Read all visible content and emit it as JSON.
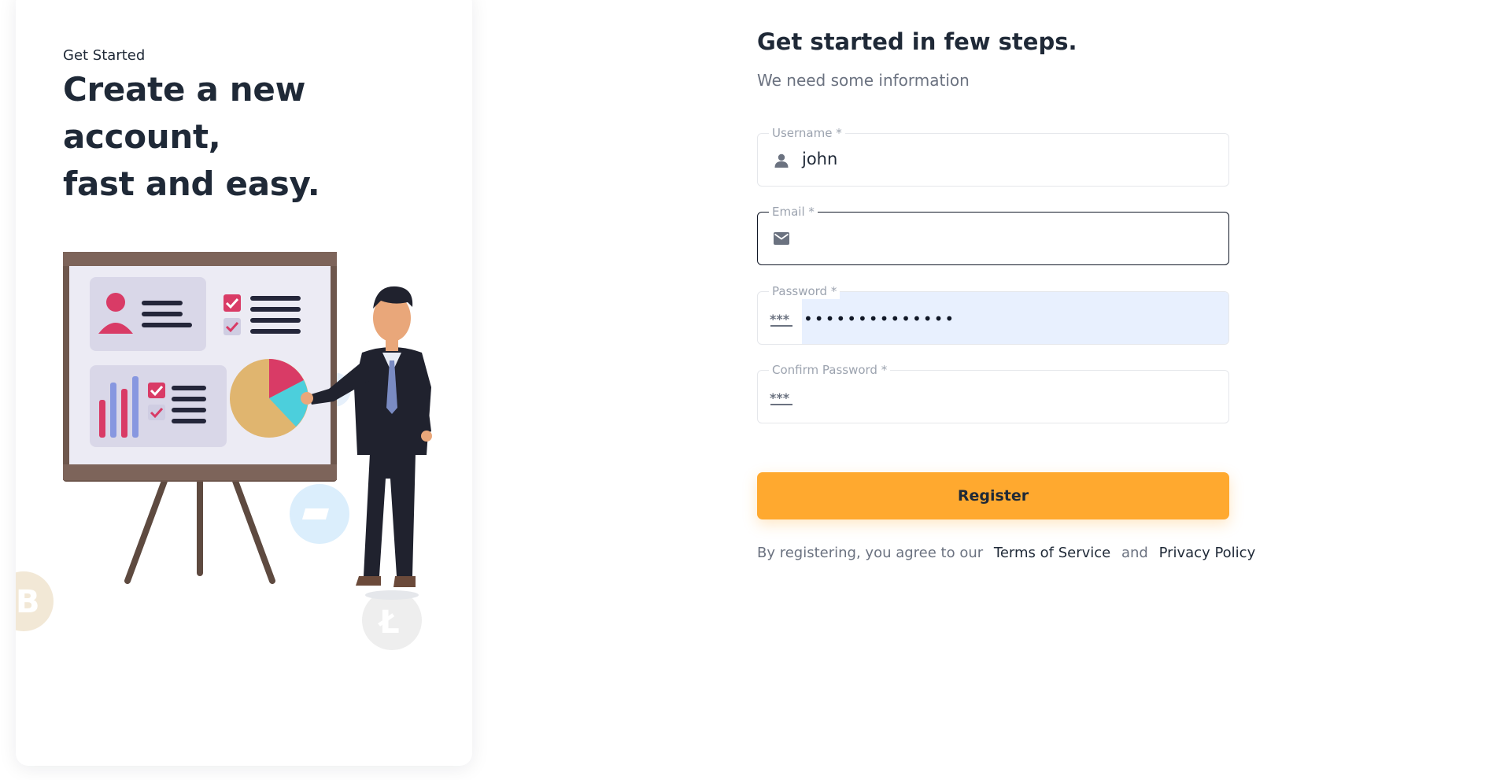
{
  "left_panel": {
    "eyebrow": "Get Started",
    "headline_line1": "Create a new account,",
    "headline_line2": "fast and easy."
  },
  "form": {
    "title": "Get started in few steps.",
    "subtitle": "We need some information",
    "fields": [
      {
        "label": "Username *",
        "value": "john",
        "icon": "person-icon"
      },
      {
        "label": "Email *",
        "value": "",
        "icon": "envelope-icon"
      },
      {
        "label": "Password *",
        "value": "••••••••••••••",
        "icon": "password-dots-icon"
      },
      {
        "label": "Confirm Password *",
        "value": "",
        "icon": "password-dots-icon"
      }
    ],
    "register_label": "Register",
    "agree_text": "By registering, you agree to our",
    "terms_link": "Terms of Service",
    "and_text": "and",
    "privacy_link": "Privacy Policy"
  },
  "colors": {
    "accent": "#ffa92f",
    "text_dark": "#1f2937",
    "text_muted": "#6b7280",
    "autofill_bg": "#e8f0fe"
  }
}
